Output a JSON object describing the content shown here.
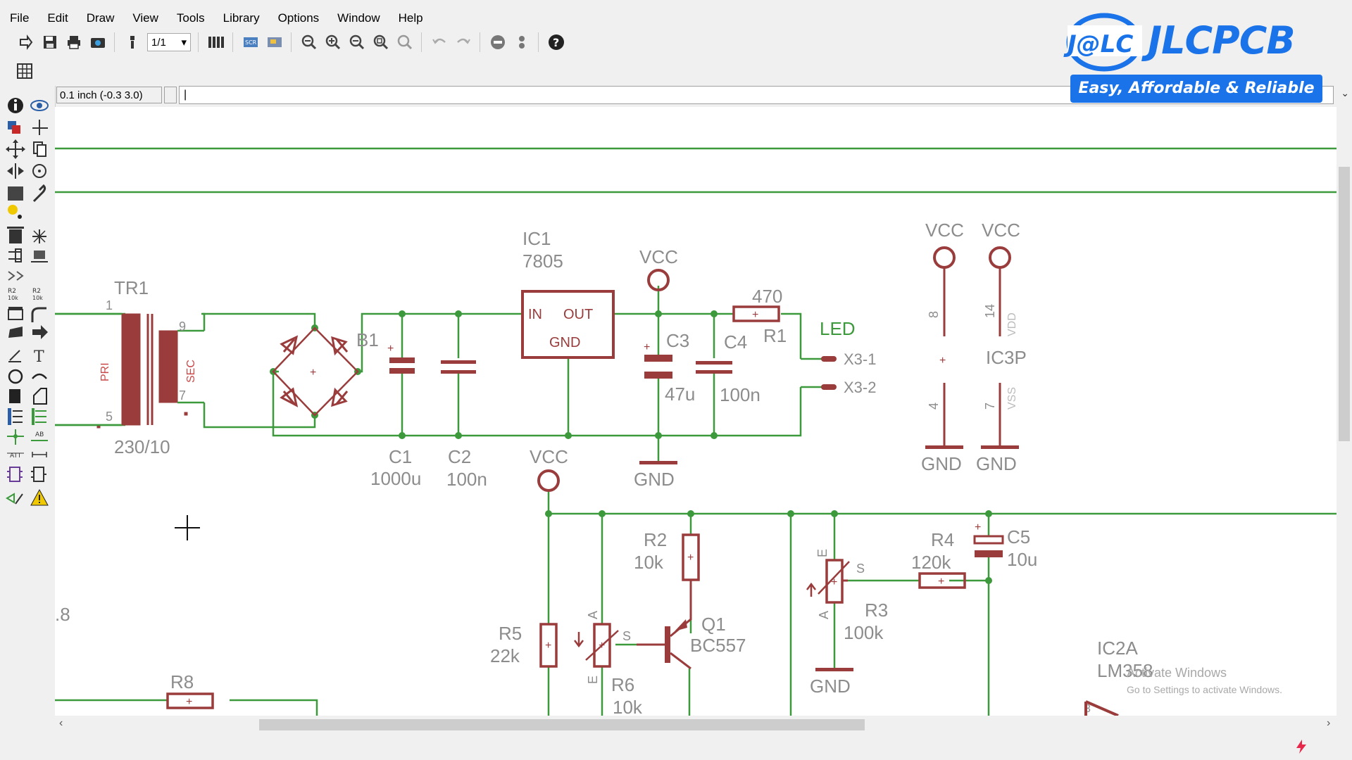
{
  "menu": [
    "File",
    "Edit",
    "Draw",
    "View",
    "Tools",
    "Library",
    "Options",
    "Window",
    "Help"
  ],
  "toolbar": {
    "sheet_value": "1/1",
    "icons": [
      "open-icon",
      "save-icon",
      "print-icon",
      "cam-icon",
      "script-icon",
      "sheet-select",
      "board-icon",
      "scr-icon",
      "ulp-icon",
      "zoom-fit-icon",
      "zoom-in-icon",
      "zoom-out-icon",
      "zoom-select-icon",
      "zoom-redraw-icon",
      "undo-icon",
      "redo-icon",
      "stop-icon",
      "go-icon",
      "help-icon"
    ]
  },
  "command": {
    "coord": "0.1 inch (-0.3 3.0)",
    "input_value": "|"
  },
  "brand": {
    "logo_text": "J@LC",
    "name": "JLCPCB",
    "tagline": "Easy, Affordable & Reliable",
    "color": "#1a73e8"
  },
  "watermark": {
    "title": "Activate Windows",
    "subtitle": "Go to Settings to activate Windows."
  },
  "schematic": {
    "wire_color": "#3c9a3c",
    "part_color": "#9a3c3c",
    "label_color": "#8c8c8c",
    "labels": {
      "tr1": "TR1",
      "tr1_pin1": "1",
      "tr1_pin5": "5",
      "tr1_pin9": "9",
      "tr1_pin7": "7",
      "tr1_pri": "PRI",
      "tr1_sec": "SEC",
      "tr1_value": "230/10",
      "b1": "B1",
      "ic1": "IC1",
      "ic1_value": "7805",
      "ic1_in": "IN",
      "ic1_out": "OUT",
      "ic1_gnd": "GND",
      "vcc1": "VCC",
      "vcc2": "VCC",
      "vcc3": "VCC",
      "vcc4": "VCC",
      "r1_value": "470",
      "r1": "R1",
      "led": "LED",
      "x3_1": "X3-1",
      "x3_2": "X3-2",
      "c3": "C3",
      "c3_value": "47u",
      "c4": "C4",
      "c4_value": "100n",
      "gnd1": "GND",
      "gnd2": "GND",
      "gnd3": "GND",
      "gnd4": "GND",
      "c1": "C1",
      "c1_value": "1000u",
      "c2": "C2",
      "c2_value": "100n",
      "ic3_pin8": "8",
      "ic3_pin14": "14",
      "ic3_vdd": "VDD",
      "ic3p": "IC3P",
      "ic3_pin4": "4",
      "ic3_pin7": "7",
      "ic3_vss": "VSS",
      "r2": "R2",
      "r2_value": "10k",
      "q1": "Q1",
      "q1_value": "BC557",
      "r5": "R5",
      "r5_value": "22k",
      "r6": "R6",
      "r6_value": "10k",
      "r6_a": "A",
      "r6_e": "E",
      "r6_s": "S",
      "r4": "R4",
      "r4_value": "120k",
      "c5": "C5",
      "c5_value": "10u",
      "r3": "R3",
      "r3_value": "100k",
      "r3_a": "A",
      "r3_e": "E",
      "r3_s": "S",
      "ic2a": "IC2A",
      "ic2a_value": "LM358",
      "ic2a_pin": "3",
      "r8": "R8",
      "left_label": ".8"
    }
  }
}
